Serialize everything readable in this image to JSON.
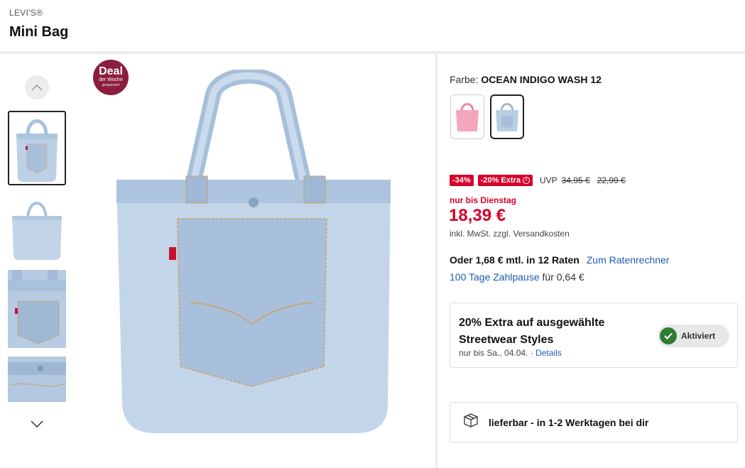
{
  "header": {
    "brand": "LEVI'S®",
    "title": "Mini Bag"
  },
  "gallery": {
    "up_icon": "chevron-up-icon",
    "down_icon": "chevron-down-icon",
    "thumbnails": [
      {
        "name": "front view",
        "active": true
      },
      {
        "name": "full view",
        "active": false
      },
      {
        "name": "pocket detail",
        "active": false
      },
      {
        "name": "top detail",
        "active": false
      }
    ],
    "deal_badge": {
      "title": "Deal",
      "line1": "der Woche",
      "line2": "gesponsert",
      "color": "#8b1e3f"
    }
  },
  "colors": {
    "label": "Farbe:",
    "selected": "OCEAN INDIGO WASH 12",
    "swatches": [
      {
        "name": "pink",
        "color": "#f4a6bd",
        "active": false
      },
      {
        "name": "ocean indigo wash 12",
        "color": "#b9cde3",
        "active": true
      }
    ]
  },
  "pricing": {
    "discount_badge": "-34%",
    "extra_badge": "-20% Extra",
    "uvp_label": "UVP",
    "uvp_price": "34,95 €",
    "old_price": "22,99 €",
    "until": "nur bis Dienstag",
    "price": "18,39 €",
    "tax_note": "inkl. MwSt. zzgl.",
    "shipping_link": "Versandkosten",
    "accent_color": "#d6002a"
  },
  "financing": {
    "rate_text": "Oder 1,68 € mtl. in 12 Raten",
    "rate_link": "Zum Ratenrechner",
    "pause_link": "100 Tage Zahlpause",
    "pause_text": "für 0,64 €"
  },
  "promo": {
    "title": "20% Extra auf ausgewählte Streetwear Styles",
    "validity": "nur bis Sa., 04.04. ·",
    "details_link": "Details",
    "status": "Aktiviert",
    "status_color": "#2e7d32"
  },
  "delivery": {
    "icon": "package-icon",
    "text": "lieferbar - in 1-2 Werktagen bei dir"
  }
}
